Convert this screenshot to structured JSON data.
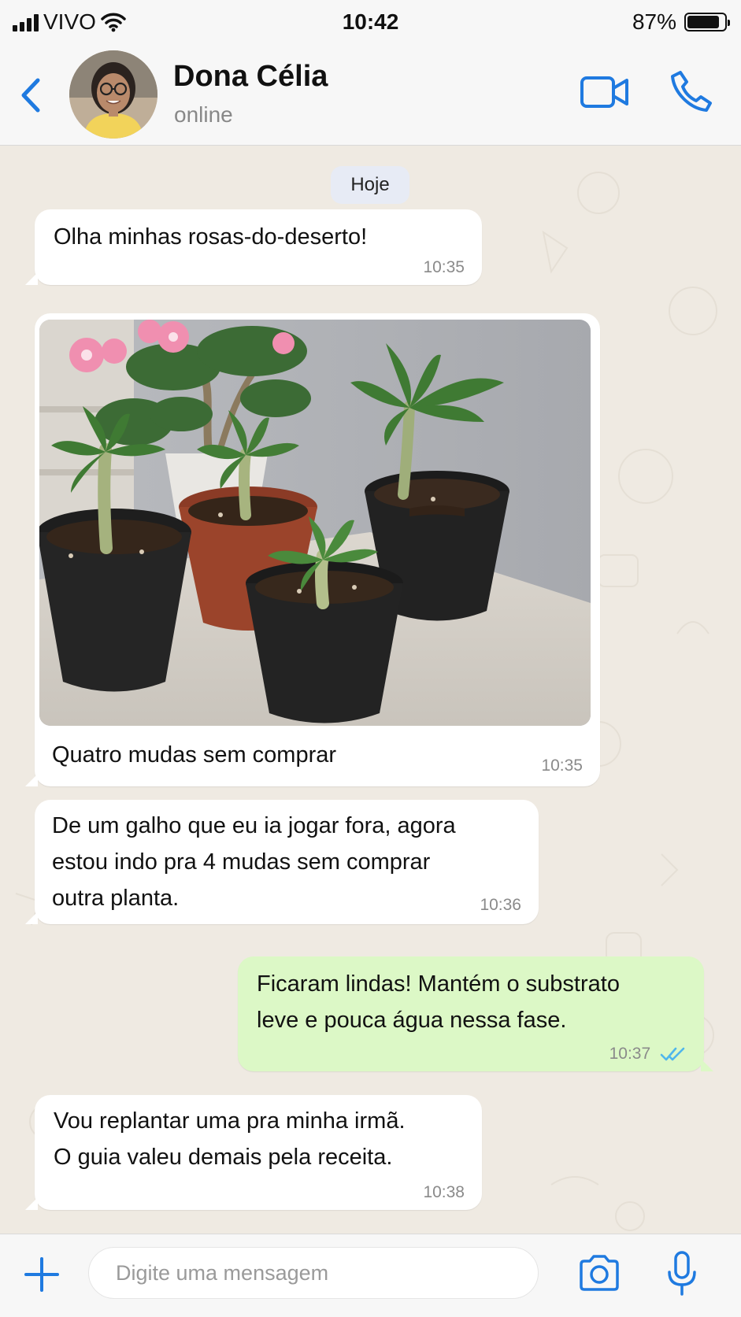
{
  "status_bar": {
    "carrier": "VIVO",
    "time": "10:42",
    "battery": "87%",
    "battery_level": 0.87
  },
  "header": {
    "contact_name": "Dona Célia",
    "contact_status": "online"
  },
  "chat": {
    "date_label": "Hoje",
    "messages": [
      {
        "direction": "incoming",
        "text": "Olha minhas rosas-do-deserto!",
        "time": "10:35"
      },
      {
        "direction": "incoming",
        "type": "image",
        "caption": "Quatro mudas sem comprar",
        "time": "10:35"
      },
      {
        "direction": "incoming",
        "text": "De um galho que eu ia jogar fora, agora\nestou indo pra 4 mudas sem comprar\noutra planta.",
        "time": "10:36"
      },
      {
        "direction": "outgoing",
        "text": "Ficaram lindas! Mantém o substrato\nleve e pouca água nessa fase.",
        "time": "10:37",
        "status": "read"
      },
      {
        "direction": "incoming",
        "text": "Vou replantar uma pra minha irmã.\nO guia valeu demais pela receita.",
        "time": "10:38"
      }
    ]
  },
  "input": {
    "placeholder": "Digite uma mensagem"
  },
  "colors": {
    "accent": "#1f7ae0",
    "incoming_bubble": "#ffffff",
    "outgoing_bubble": "#dcf8c6",
    "read_ticks": "#4fb6ec",
    "chat_bg": "#efeae2"
  },
  "icons": [
    "signal-icon",
    "wifi-icon",
    "battery-icon",
    "back-icon",
    "video-call-icon",
    "phone-icon",
    "read-receipt-icon",
    "plus-icon",
    "camera-icon",
    "mic-icon"
  ]
}
